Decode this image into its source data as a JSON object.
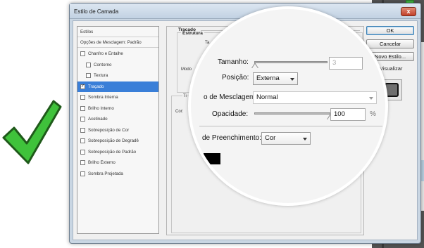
{
  "dialog": {
    "title": "Estilo de Camada",
    "close_label": "x"
  },
  "styles_panel": {
    "header": "Estilos",
    "blend_options": "Opções de Mesclagem: Padrão",
    "items": [
      {
        "label": "Chanfro e Entalhe",
        "checked": false
      },
      {
        "label": "Contorno",
        "checked": false
      },
      {
        "label": "Textura",
        "checked": false
      },
      {
        "label": "Traçado",
        "checked": true
      },
      {
        "label": "Sombra Interna",
        "checked": false
      },
      {
        "label": "Brilho Interno",
        "checked": false
      },
      {
        "label": "Acetinado",
        "checked": false
      },
      {
        "label": "Sobreposição de Cor",
        "checked": false
      },
      {
        "label": "Sobreposição de Degradê",
        "checked": false
      },
      {
        "label": "Sobreposição de Padrão",
        "checked": false
      },
      {
        "label": "Brilho Externo",
        "checked": false
      },
      {
        "label": "Sombra Projetada",
        "checked": false
      }
    ],
    "check_glyph": "✓"
  },
  "settings": {
    "section_title": "Traçado",
    "group_title": "Estrutura",
    "partial_ta": "Ta",
    "partial_modo": "Modo",
    "partial_t": "Ti",
    "partial_cor": "Cor:"
  },
  "lens": {
    "size_label": "Tamanho:",
    "size_value": "3",
    "size_level": 0.01,
    "position_label": "Posição:",
    "position_value": "Externa",
    "blend_label": "o de Mesclagem:",
    "blend_value": "Normal",
    "opacity_label": "Opacidade:",
    "opacity_value": "100",
    "opacity_unit": "%",
    "opacity_level": 1.0,
    "fill_label": "de Preenchimento:",
    "fill_value": "Cor",
    "fill_color": "#000000"
  },
  "buttons": {
    "ok": "OK",
    "cancel": "Cancelar",
    "new_style": "Novo Estilo...",
    "visualize": "Visualizar",
    "visualize_checked": true
  },
  "icons": {
    "check_mark": "green-check-icon"
  },
  "colors": {
    "selected": "#3a7fd8",
    "check_green": "#3fc23b"
  }
}
